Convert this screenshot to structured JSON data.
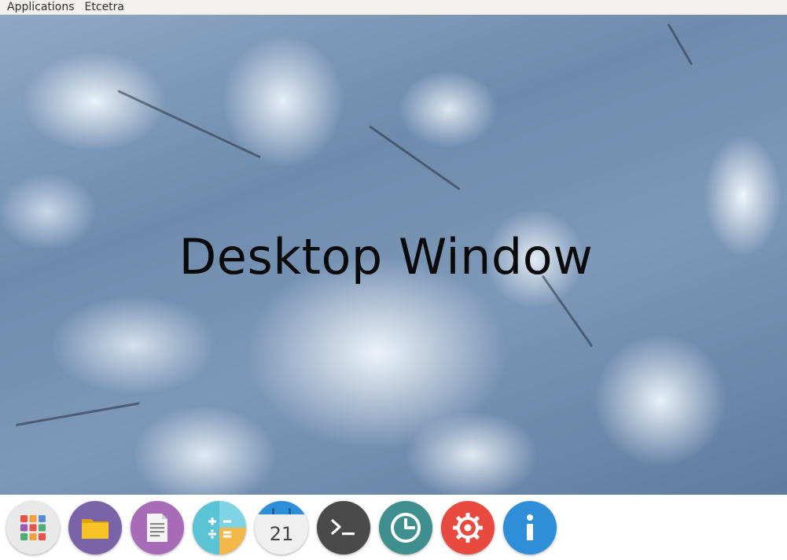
{
  "menubar": {
    "items": [
      {
        "label": "Applications"
      },
      {
        "label": "Etcetra"
      }
    ]
  },
  "desktop": {
    "title": "Desktop Window",
    "wallpaper": "snowy-pine-forest-aerial"
  },
  "dock": {
    "items": [
      {
        "name": "app-grid-icon",
        "color": "#e6e6e6"
      },
      {
        "name": "files-icon",
        "color": "#7a63a6"
      },
      {
        "name": "text-editor-icon",
        "color": "#a86bb8"
      },
      {
        "name": "calculator-icon",
        "color": "#5bc3d6"
      },
      {
        "name": "calendar-icon",
        "color": "#eeeeee",
        "day": "21"
      },
      {
        "name": "terminal-icon",
        "color": "#4a4a4a"
      },
      {
        "name": "system-monitor-icon",
        "color": "#3f8f8f"
      },
      {
        "name": "settings-icon",
        "color": "#e84a3f"
      },
      {
        "name": "info-icon",
        "color": "#2f8ed8"
      }
    ]
  }
}
